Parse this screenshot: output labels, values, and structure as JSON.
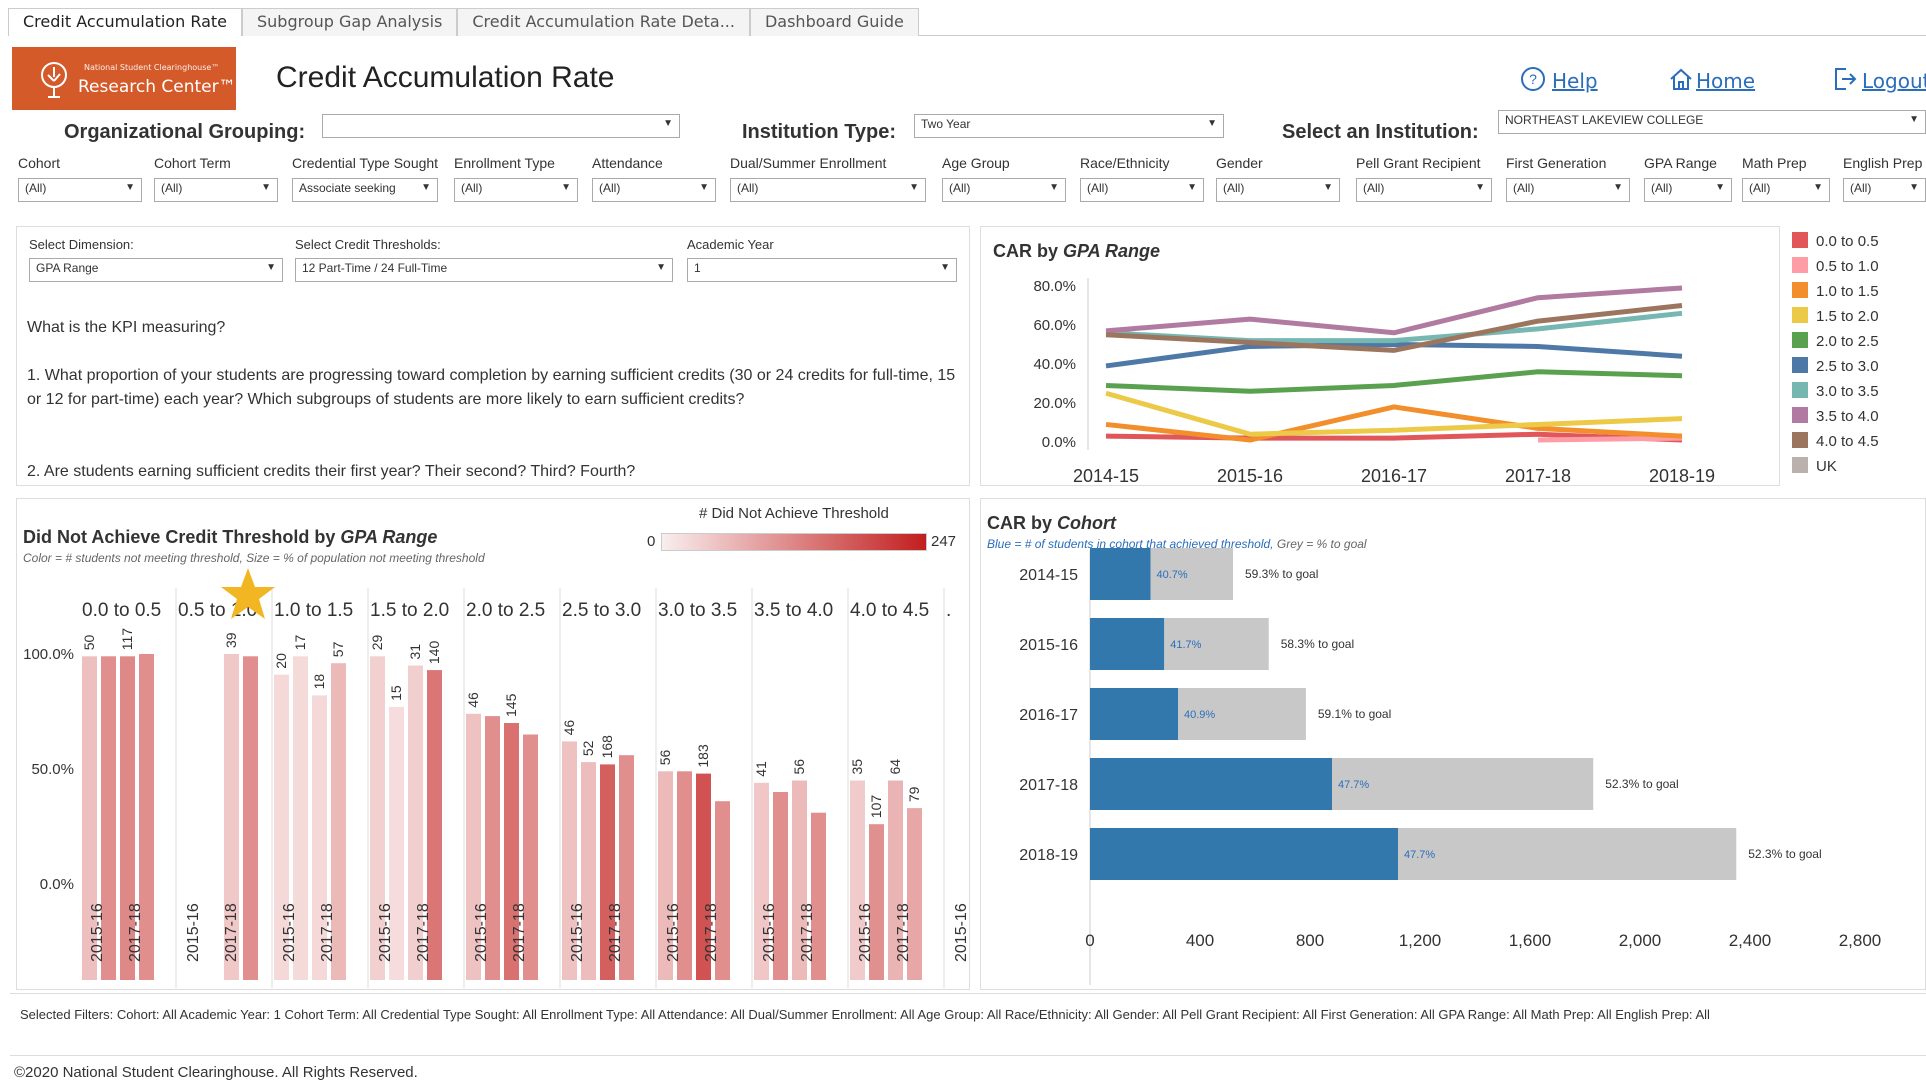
{
  "tabs": [
    {
      "label": "Credit Accumulation Rate",
      "active": true
    },
    {
      "label": "Subgroup Gap Analysis",
      "active": false
    },
    {
      "label": "Credit Accumulation Rate Deta...",
      "active": false
    },
    {
      "label": "Dashboard Guide",
      "active": false
    }
  ],
  "header": {
    "logo_small": "National Student Clearinghouse™",
    "logo_main": "Research Center™",
    "title": "Credit Accumulation Rate",
    "help": "Help",
    "home": "Home",
    "logout": "Logout"
  },
  "top_filters": {
    "org_label": "Organizational Grouping:",
    "org_value": "",
    "inst_type_label": "Institution Type:",
    "inst_type_value": "Two Year",
    "institution_label": "Select an Institution:",
    "institution_value": "NORTHEAST LAKEVIEW COLLEGE"
  },
  "filters": [
    {
      "label": "Cohort",
      "value": "(All)"
    },
    {
      "label": "Cohort Term",
      "value": "(All)"
    },
    {
      "label": "Credential Type Sought",
      "value": "Associate seeking"
    },
    {
      "label": "Enrollment Type",
      "value": "(All)"
    },
    {
      "label": "Attendance",
      "value": "(All)"
    },
    {
      "label": "Dual/Summer Enrollment",
      "value": "(All)"
    },
    {
      "label": "Age Group",
      "value": "(All)"
    },
    {
      "label": "Race/Ethnicity",
      "value": "(All)"
    },
    {
      "label": "Gender",
      "value": "(All)"
    },
    {
      "label": "Pell Grant Recipient",
      "value": "(All)"
    },
    {
      "label": "First Generation",
      "value": "(All)"
    },
    {
      "label": "GPA Range",
      "value": "(All)"
    },
    {
      "label": "Math Prep",
      "value": "(All)"
    },
    {
      "label": "English Prep",
      "value": "(All)"
    }
  ],
  "kpi_panel": {
    "dimension_label": "Select Dimension:",
    "dimension_value": "GPA Range",
    "threshold_label": "Select Credit Thresholds:",
    "threshold_value": "12 Part-Time / 24 Full-Time",
    "year_label": "Academic Year",
    "year_value": "1",
    "question_heading": "What is the KPI measuring?",
    "q1": "1. What proportion of your students are progressing toward completion by earning sufficient credits (30 or 24 credits for full-time, 15 or 12 for part-time) each year? Which subgroups of students are more likely to earn sufficient credits?",
    "q2": "2. Are students earning sufficient credits their first year? Their second? Third? Fourth?"
  },
  "car_gpa": {
    "title_prefix": "CAR by ",
    "title_em": "GPA Range"
  },
  "not_achieve": {
    "title_prefix": "Did Not Achieve Credit Threshold by ",
    "title_em": "GPA Range",
    "subtitle": "Color = # students not meeting threshold, Size =  % of population not meeting threshold",
    "legend_title": "# Did Not Achieve Threshold",
    "legend_min": "0",
    "legend_max": "247"
  },
  "car_cohort": {
    "title_prefix": "CAR by ",
    "title_em": "Cohort",
    "subtitle_blue": "Blue = # of students in cohort that achieved threshold,",
    "subtitle_grey": " Grey = % to goal"
  },
  "footer": {
    "filters_text": "Selected Filters:   Cohort: All   Academic Year: 1   Cohort Term: All   Credential Type Sought: All   Enrollment Type: All   Attendance: All   Dual/Summer Enrollment: All   Age Group: All   Race/Ethnicity: All   Gender: All   Pell Grant Recipient: All   First Generation: All   GPA Range: All   Math Prep: All   English Prep: All",
    "copyright": "©2020 National Student Clearinghouse. All Rights Reserved."
  },
  "colors": {
    "brand_orange": "#d45a2a",
    "link_blue": "#2a6ebb",
    "bar_blue": "#3378ac",
    "bar_grey": "#c8c8c8"
  },
  "chart_data": [
    {
      "id": "car_by_gpa",
      "type": "line",
      "title": "CAR by GPA Range",
      "x": [
        "2014-15",
        "2015-16",
        "2016-17",
        "2017-18",
        "2018-19"
      ],
      "ylim": [
        0,
        80
      ],
      "yticks": [
        "0.0%",
        "20.0%",
        "40.0%",
        "60.0%",
        "80.0%"
      ],
      "legend_position": "right",
      "series": [
        {
          "name": "0.0 to 0.5",
          "color": "#e15759",
          "values": [
            3,
            2,
            2,
            4,
            1
          ]
        },
        {
          "name": "0.5 to 1.0",
          "color": "#ff9da7",
          "values": [
            null,
            null,
            null,
            1,
            2
          ]
        },
        {
          "name": "1.0 to 1.5",
          "color": "#f28e2b",
          "values": [
            9,
            1,
            18,
            7,
            3
          ]
        },
        {
          "name": "1.5 to 2.0",
          "color": "#edc948",
          "values": [
            25,
            4,
            6,
            9,
            12
          ]
        },
        {
          "name": "2.0 to 2.5",
          "color": "#59a14f",
          "values": [
            29,
            26,
            29,
            36,
            34
          ]
        },
        {
          "name": "2.5 to 3.0",
          "color": "#4e79a7",
          "values": [
            39,
            49,
            50,
            49,
            44
          ]
        },
        {
          "name": "3.0 to 3.5",
          "color": "#76b7b2",
          "values": [
            56,
            52,
            52,
            58,
            66
          ]
        },
        {
          "name": "3.5 to 4.0",
          "color": "#b07aa1",
          "values": [
            57,
            63,
            56,
            74,
            79
          ]
        },
        {
          "name": "4.0 to 4.5",
          "color": "#9c755f",
          "values": [
            55,
            51,
            47,
            62,
            70
          ]
        },
        {
          "name": "UK",
          "color": "#bab0ac",
          "values": [
            null,
            null,
            null,
            null,
            null
          ]
        }
      ]
    },
    {
      "id": "did_not_achieve",
      "type": "bar",
      "title": "Did Not Achieve Credit Threshold by GPA Range",
      "ylim": [
        0,
        120
      ],
      "yticks": [
        "0.0%",
        "50.0%",
        "100.0%"
      ],
      "groups": [
        "0.0 to 0.5",
        "0.5 to 1.0",
        "1.0 to 1.5",
        "1.5 to 2.0",
        "2.0 to 2.5",
        "2.5 to 3.0",
        "3.0 to 3.5",
        "3.5 to 4.0",
        "4.0 to 4.5",
        "."
      ],
      "x_tick_labels": [
        "2015-16",
        "2017-18"
      ],
      "color_scale": [
        0,
        247
      ],
      "bars": [
        [
          {
            "pct": 99,
            "count": 50
          },
          {
            "pct": 99,
            "count": null
          },
          {
            "pct": 99,
            "count": 117
          },
          {
            "pct": 100,
            "count": null
          }
        ],
        [
          {
            "pct": 100,
            "count": 39
          },
          {
            "pct": 99,
            "count": null
          }
        ],
        [
          {
            "pct": 91,
            "count": 20
          },
          {
            "pct": 99,
            "count": 17
          },
          {
            "pct": 82,
            "count": 18
          },
          {
            "pct": 96,
            "count": 57
          }
        ],
        [
          {
            "pct": 99,
            "count": 29
          },
          {
            "pct": 77,
            "count": 15
          },
          {
            "pct": 95,
            "count": 31
          },
          {
            "pct": 93,
            "count": 140
          }
        ],
        [
          {
            "pct": 74,
            "count": 46
          },
          {
            "pct": 73,
            "count": null
          },
          {
            "pct": 70,
            "count": 145
          },
          {
            "pct": 65,
            "count": null
          }
        ],
        [
          {
            "pct": 62,
            "count": 46
          },
          {
            "pct": 53,
            "count": 52
          },
          {
            "pct": 52,
            "count": 168
          },
          {
            "pct": 56,
            "count": null
          }
        ],
        [
          {
            "pct": 49,
            "count": 56
          },
          {
            "pct": 49,
            "count": null
          },
          {
            "pct": 48,
            "count": 183
          },
          {
            "pct": 36,
            "count": null
          }
        ],
        [
          {
            "pct": 44,
            "count": 41
          },
          {
            "pct": 40,
            "count": null
          },
          {
            "pct": 45,
            "count": 56
          },
          {
            "pct": 31,
            "count": null
          }
        ],
        [
          {
            "pct": 45,
            "count": 35
          },
          {
            "pct": 26,
            "count": 107
          },
          {
            "pct": 45,
            "count": 64
          },
          {
            "pct": 33,
            "count": 79
          }
        ]
      ]
    },
    {
      "id": "car_by_cohort",
      "type": "bar",
      "title": "CAR by Cohort",
      "categories": [
        "2014-15",
        "2015-16",
        "2016-17",
        "2017-18",
        "2018-19"
      ],
      "xlim": [
        0,
        2800
      ],
      "xticks": [
        "0",
        "400",
        "800",
        "1,200",
        "1,600",
        "2,000",
        "2,400",
        "2,800"
      ],
      "series": [
        {
          "name": "achieved",
          "values": [
            220,
            270,
            320,
            880,
            1120
          ],
          "labels": [
            "40.7%",
            "41.7%",
            "40.9%",
            "47.7%",
            "47.7%"
          ]
        },
        {
          "name": "to goal",
          "values": [
            300,
            380,
            465,
            950,
            1230
          ],
          "labels": [
            "59.3% to goal",
            "58.3% to goal",
            "59.1% to goal",
            "52.3% to goal",
            "52.3% to goal"
          ]
        }
      ]
    }
  ]
}
